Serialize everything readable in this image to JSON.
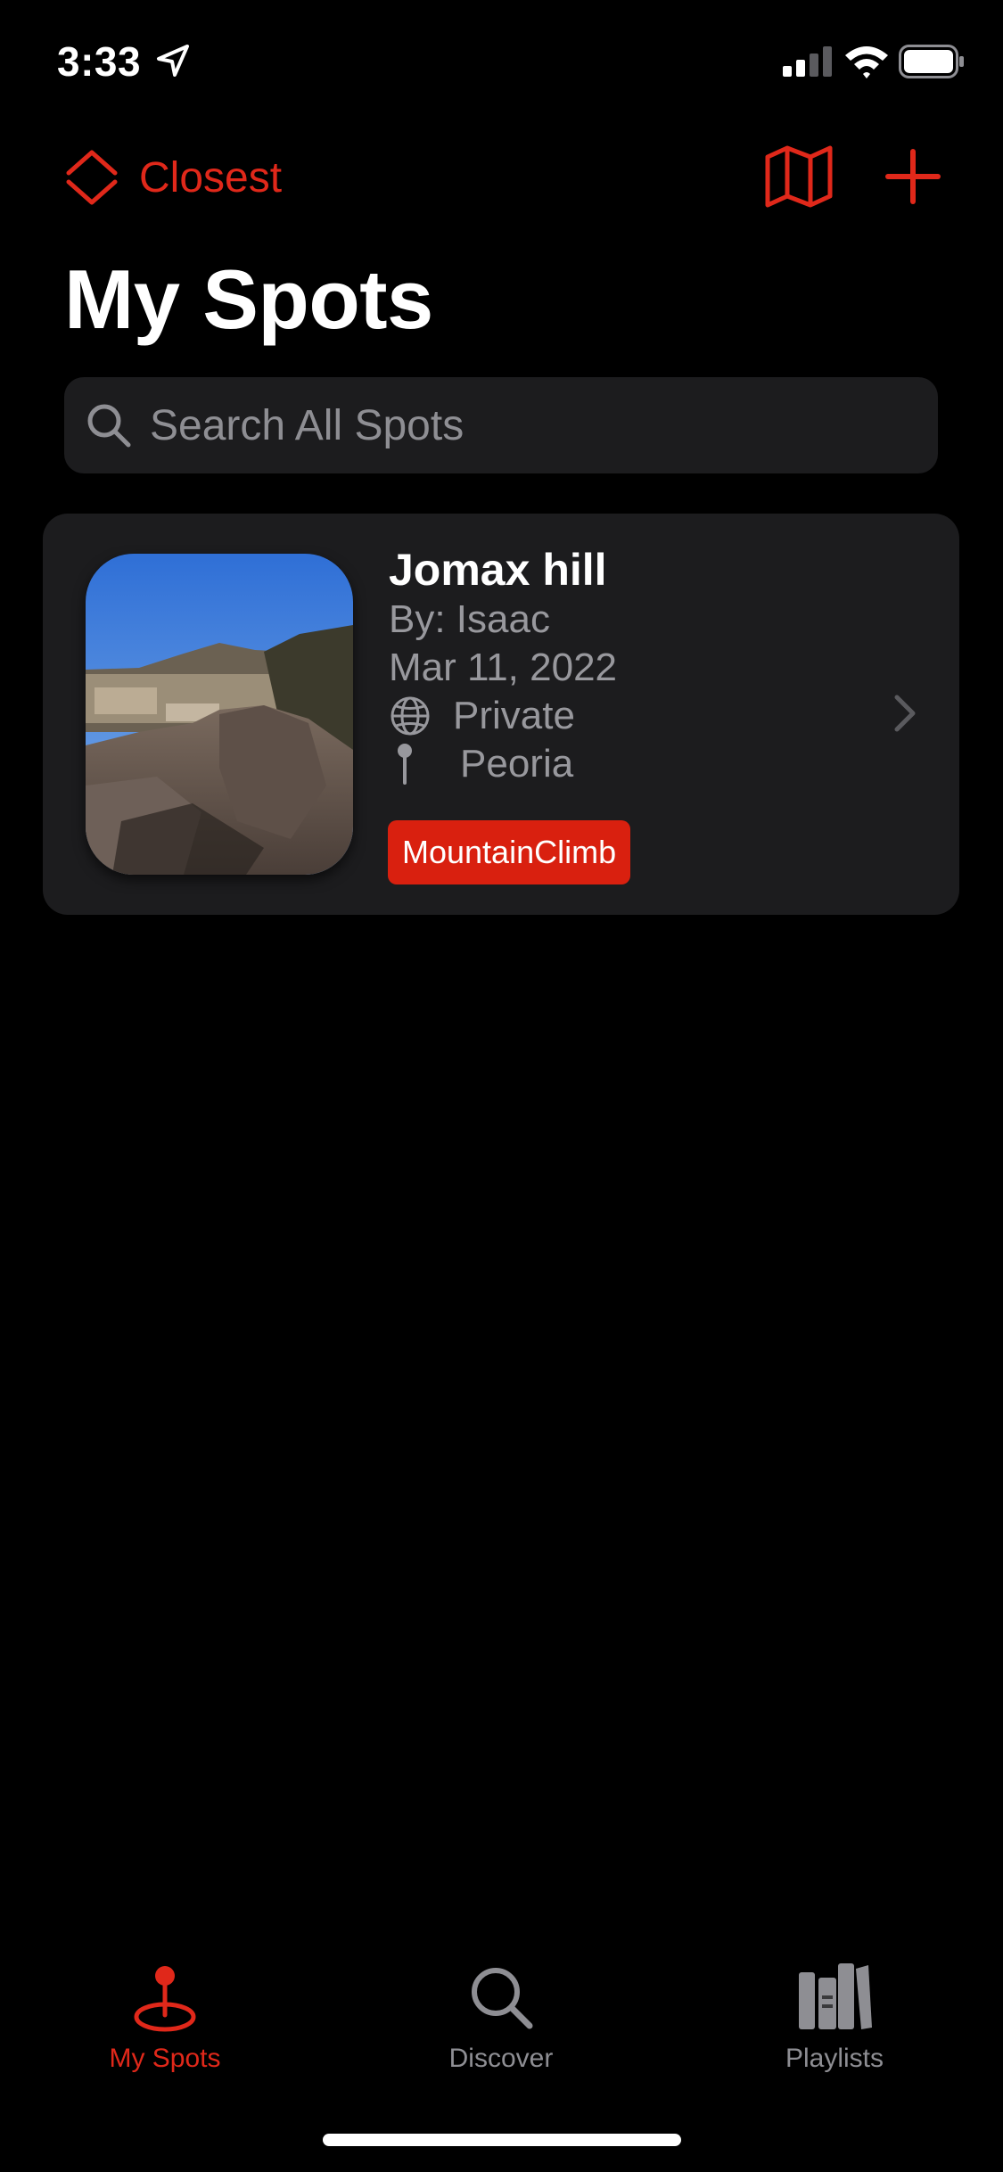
{
  "status_bar": {
    "time": "3:33",
    "icons": [
      "location-arrow-icon",
      "cellular-signal-icon",
      "wifi-icon",
      "battery-icon"
    ]
  },
  "nav": {
    "sort_label": "Closest",
    "sort_icon": "chevron-up-down-icon",
    "map_icon": "map-icon",
    "add_icon": "plus-icon"
  },
  "page": {
    "title": "My Spots"
  },
  "search": {
    "placeholder": "Search All Spots",
    "value": ""
  },
  "spots": [
    {
      "title": "Jomax hill",
      "author": "By: Isaac",
      "date": "Mar 11, 2022",
      "visibility": "Private",
      "location": "Peoria",
      "tag": "MountainClimb"
    }
  ],
  "tab_bar": {
    "items": [
      {
        "label": "My Spots",
        "icon": "pin-icon",
        "active": true
      },
      {
        "label": "Discover",
        "icon": "magnifier-icon",
        "active": false
      },
      {
        "label": "Playlists",
        "icon": "books-icon",
        "active": false
      }
    ]
  },
  "colors": {
    "accent": "#e0281a",
    "background": "#000000",
    "card": "#1c1c1e",
    "secondary_text": "#98989d",
    "tag": "#d9200f",
    "inactive_tab": "#8e8e93"
  }
}
